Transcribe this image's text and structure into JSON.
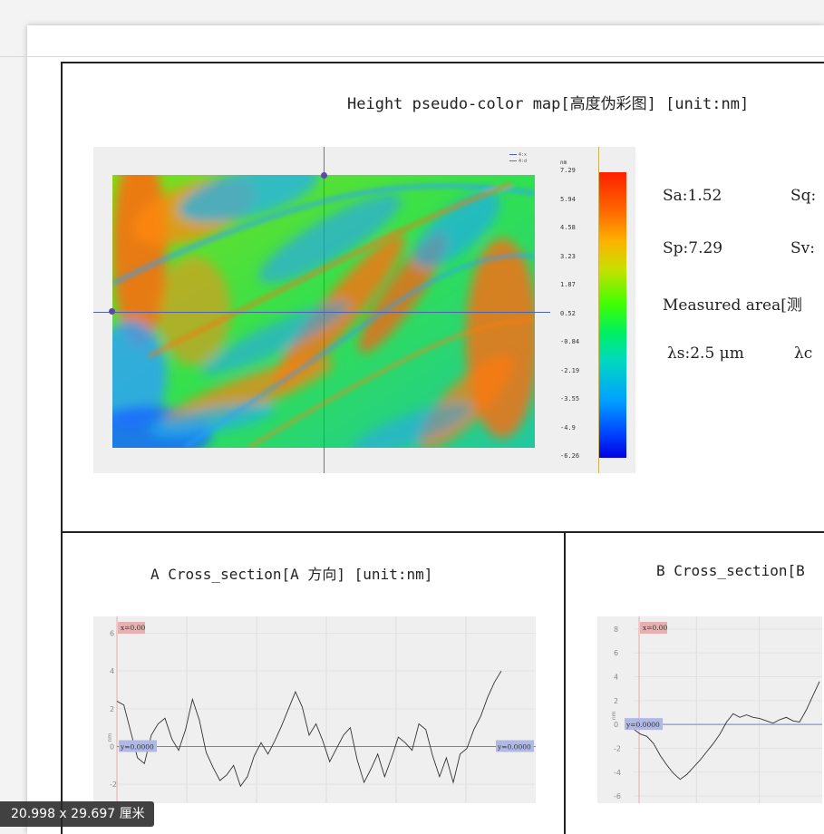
{
  "map": {
    "title": "Height pseudo-color map[高度伪彩图] [unit:nm]",
    "unit": "nm",
    "legend": [
      "4:x",
      "4:d"
    ],
    "colorbar_ticks": [
      "7.29",
      "5.94",
      "4.58",
      "3.23",
      "1.87",
      "0.52",
      "-0.84",
      "-2.19",
      "-3.55",
      "-4.9",
      "-6.26"
    ],
    "colors": {
      "crosshair_a": "#d05050",
      "crosshair_b": "#5060b0"
    }
  },
  "params": {
    "sa": "Sa:1.52",
    "sq": "Sq:",
    "sp": "Sp:7.29",
    "sv": "Sv:",
    "area": "Measured area[测",
    "lambda_s": "λs:2.5 μm",
    "lambda_c": "λc"
  },
  "section_a": {
    "title": "A Cross_section[A 方向] [unit:nm]",
    "x_label": "x=0.00",
    "y_label": "y=0.0000",
    "y_label_right": "y=0.0000",
    "axis_label": "nm"
  },
  "section_b": {
    "title": "B Cross_section[B",
    "x_label": "x=0.00",
    "y_label": "y=0.0000",
    "axis_label": "nm"
  },
  "chart_data": [
    {
      "type": "line",
      "title": "A Cross_section[A 方向] [unit:nm]",
      "ylim": [
        -3,
        6.6
      ],
      "yticks": [
        6,
        4,
        2,
        0,
        -2
      ],
      "x": [
        0,
        0.25,
        0.5,
        0.75,
        1.0,
        1.25,
        1.5,
        1.75,
        2.0,
        2.25,
        2.5,
        2.75,
        3.0,
        3.25,
        3.5,
        3.75,
        4.0,
        4.25,
        4.5,
        4.75,
        5.0,
        5.25,
        5.5,
        5.75,
        6.0,
        6.25,
        6.5,
        6.75,
        7.0,
        7.25,
        7.5,
        7.75,
        8.0,
        8.25,
        8.5,
        8.75,
        9.0,
        9.25,
        9.5,
        9.75,
        10.0,
        10.25,
        10.5,
        10.75,
        11.0,
        11.25,
        11.5,
        11.75,
        12.0,
        12.25,
        12.5,
        12.75,
        13.0,
        13.25,
        13.5,
        13.75,
        14.0
      ],
      "series": [
        {
          "values": [
            2.4,
            2.2,
            0.8,
            -0.6,
            -0.9,
            0.6,
            1.2,
            1.5,
            0.4,
            -0.2,
            0.9,
            2.5,
            1.4,
            -0.3,
            -1.1,
            -1.8,
            -1.5,
            -1.0,
            -2.1,
            -1.6,
            -0.5,
            0.2,
            -0.4,
            0.3,
            1.1,
            2.0,
            2.9,
            2.1,
            0.6,
            1.2,
            0.3,
            -0.8,
            -0.1,
            0.6,
            1.0,
            -0.7,
            -1.9,
            -1.2,
            -0.4,
            -1.6,
            -0.6,
            0.5,
            0.2,
            -0.2,
            1.2,
            0.9,
            -0.5,
            -1.6,
            -0.6,
            -1.9,
            -0.4,
            -0.1,
            0.9,
            1.6,
            2.6,
            3.4,
            4.0
          ]
        }
      ]
    },
    {
      "type": "line",
      "title": "B Cross_section[B",
      "ylim": [
        -6.6,
        8.6
      ],
      "yticks": [
        8,
        6,
        4,
        2,
        0,
        -2,
        -4,
        -6
      ],
      "x": [
        0,
        0.5,
        1.0,
        1.5,
        2.0,
        2.5,
        3.0,
        3.5,
        4.0,
        4.5,
        5.0,
        5.5,
        6.0,
        6.5,
        7.0,
        7.5,
        8.0,
        8.5,
        9.0,
        9.5,
        10.0,
        10.5,
        11.0,
        11.5,
        12.0,
        12.5,
        13.0,
        13.5,
        14.0
      ],
      "series": [
        {
          "values": [
            -0.4,
            -0.8,
            -1.0,
            -1.6,
            -2.6,
            -3.4,
            -4.1,
            -4.6,
            -4.2,
            -3.6,
            -3.0,
            -2.3,
            -1.6,
            -0.8,
            0.2,
            0.9,
            0.6,
            0.8,
            0.6,
            0.5,
            0.3,
            0.1,
            0.4,
            0.6,
            0.3,
            0.2,
            1.2,
            2.4,
            3.6
          ]
        }
      ]
    }
  ]
}
